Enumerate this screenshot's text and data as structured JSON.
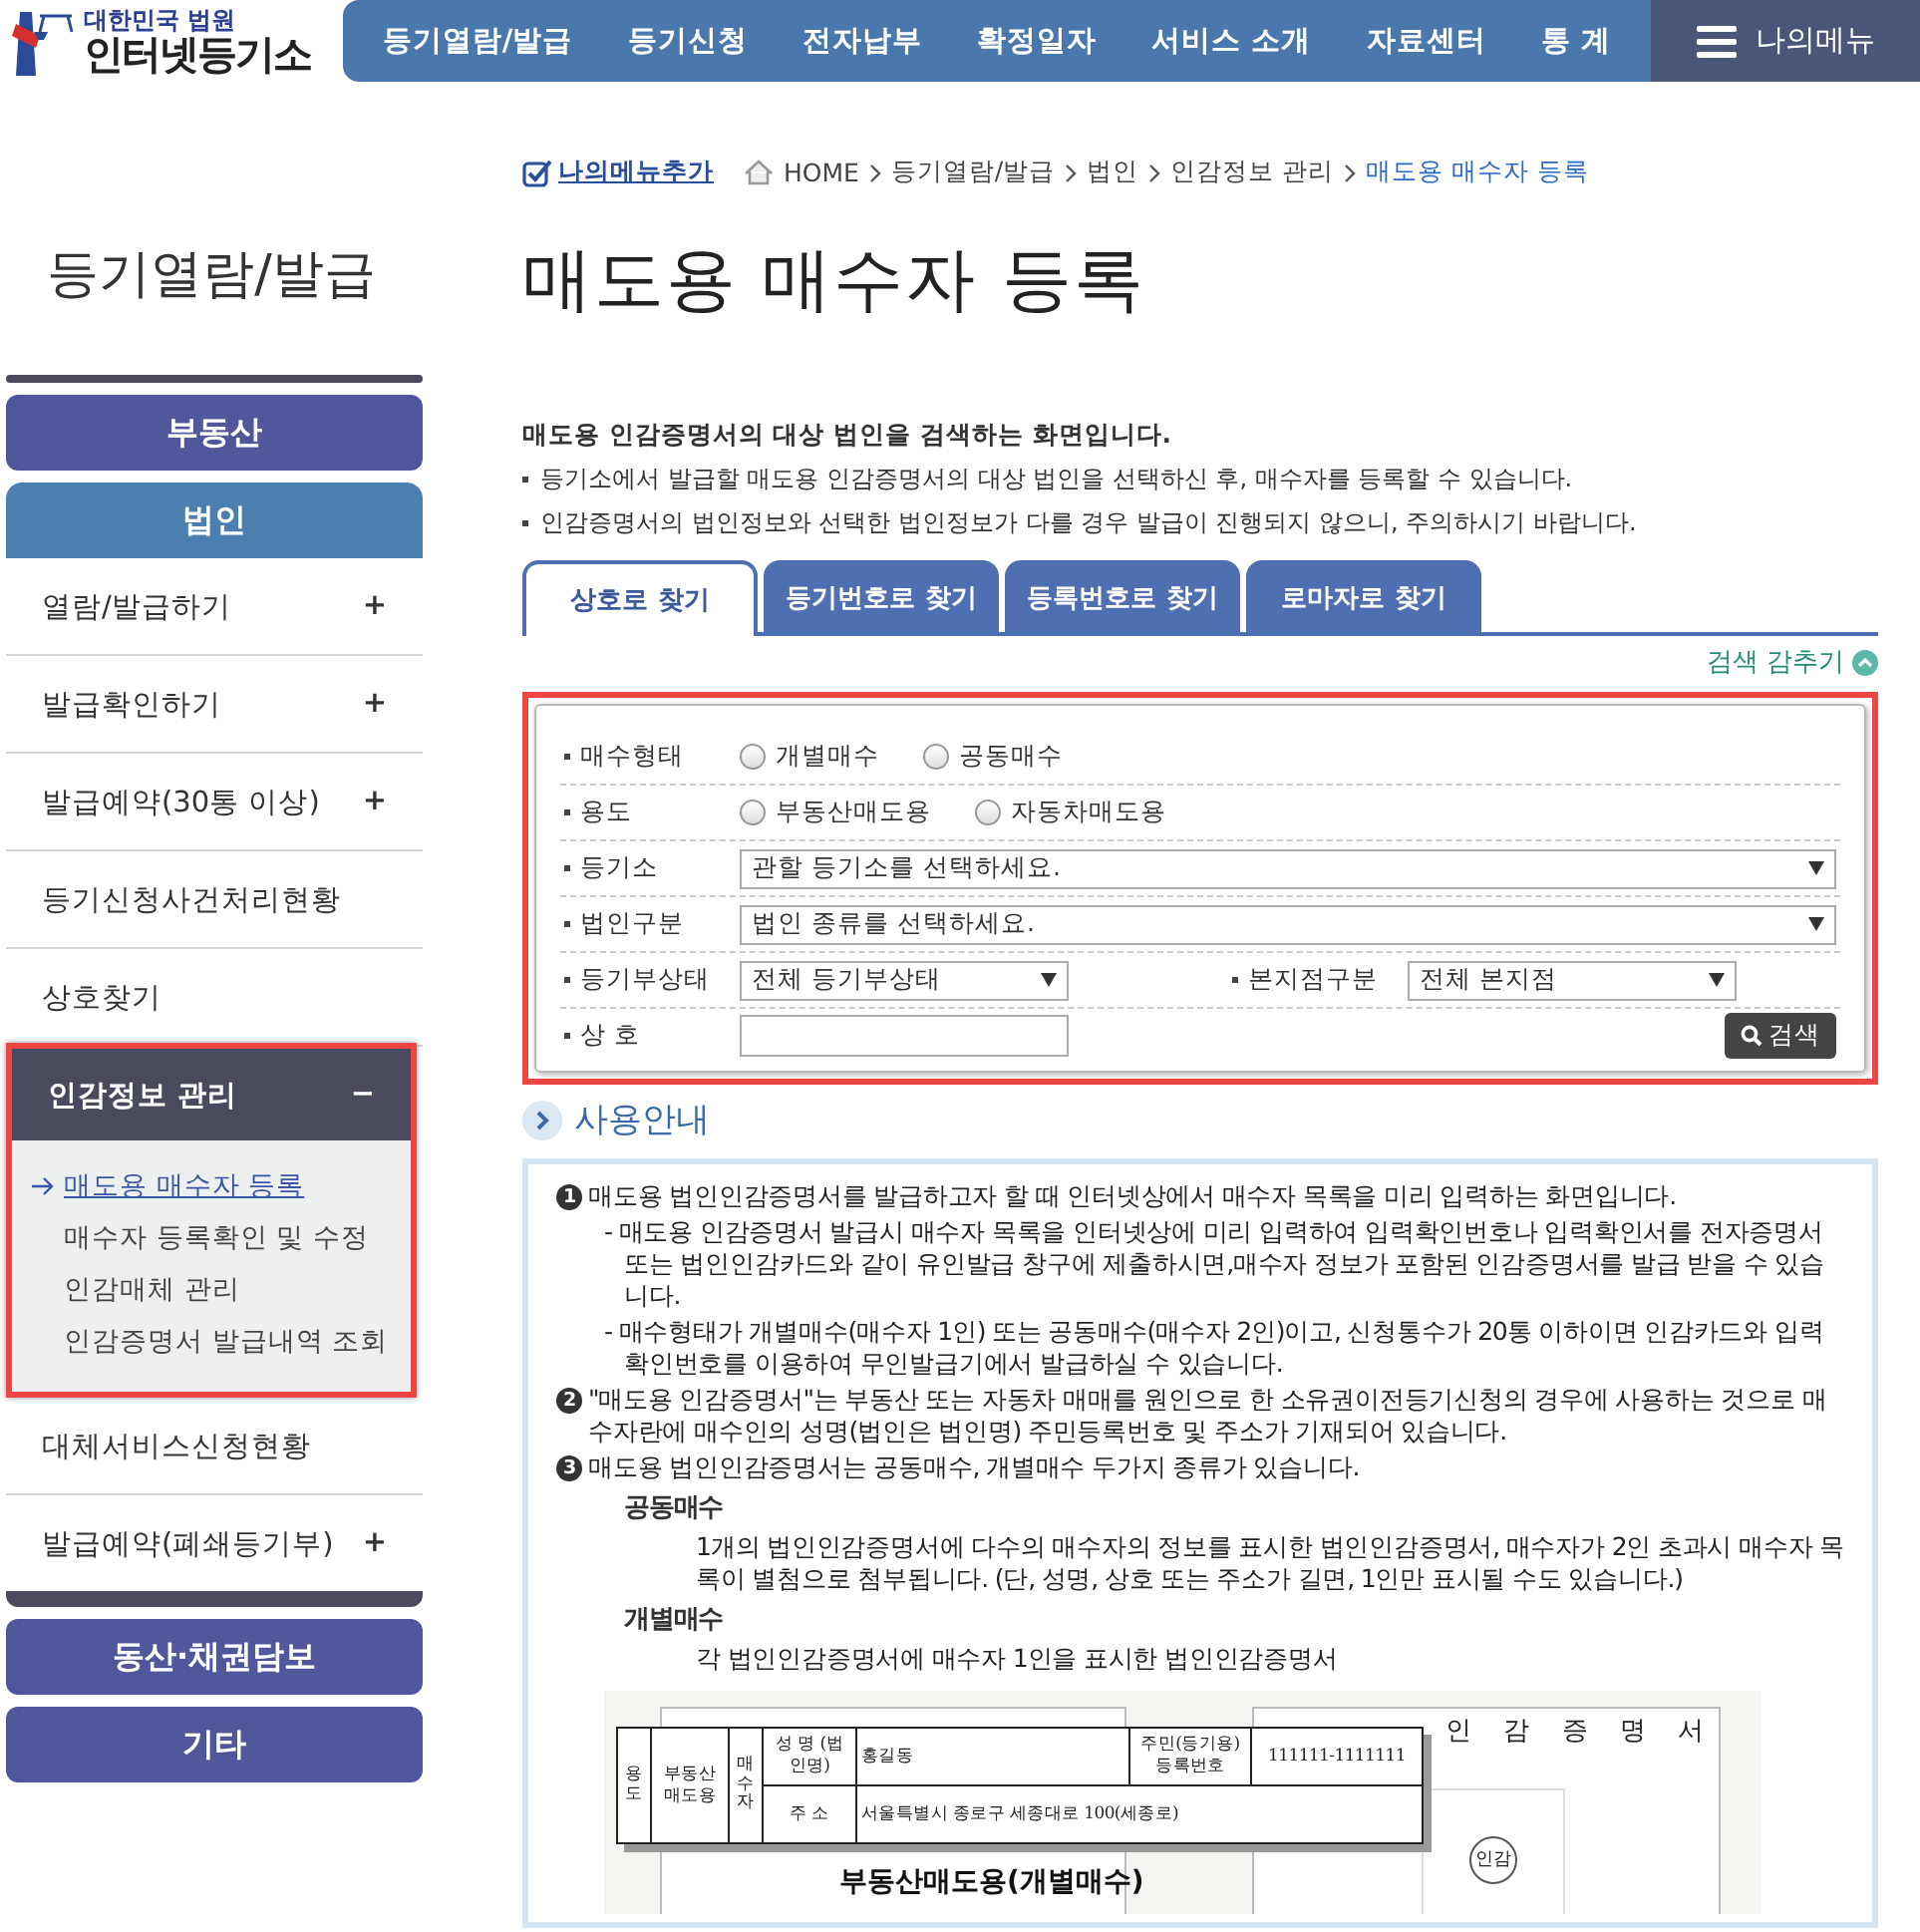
{
  "header": {
    "logo_top": "대한민국 법원",
    "logo_name": "인터넷등기소",
    "nav": [
      "등기열람/발급",
      "등기신청",
      "전자납부",
      "확정일자",
      "서비스 소개",
      "자료센터",
      "통 계"
    ],
    "my_menu": "나의메뉴"
  },
  "sidebar": {
    "title": "등기열람/발급",
    "sections": [
      {
        "label": "부동산",
        "selected": false
      },
      {
        "label": "법인",
        "selected": true,
        "items": [
          {
            "label": "열람/발급하기",
            "toggle": "+",
            "expanded": false
          },
          {
            "label": "발급확인하기",
            "toggle": "+",
            "expanded": false
          },
          {
            "label": "발급예약(30통 이상)",
            "toggle": "+",
            "expanded": false
          },
          {
            "label": "등기신청사건처리현황",
            "expanded": false
          },
          {
            "label": "상호찾기",
            "expanded": false
          },
          {
            "label": "인감정보 관리",
            "toggle": "−",
            "expanded": true,
            "highlighted": true,
            "children": [
              {
                "label": "매도용 매수자 등록",
                "selected": true
              },
              {
                "label": "매수자 등록확인 및 수정",
                "selected": false
              },
              {
                "label": "인감매체 관리",
                "selected": false
              },
              {
                "label": "인감증명서 발급내역 조회",
                "selected": false
              }
            ]
          },
          {
            "label": "대체서비스신청현황",
            "expanded": false
          },
          {
            "label": "발급예약(폐쇄등기부)",
            "toggle": "+",
            "expanded": false
          }
        ]
      },
      {
        "label": "동산·채권담보",
        "selected": false
      },
      {
        "label": "기타",
        "selected": false
      }
    ]
  },
  "breadcrumb": {
    "add_menu": "나의메뉴추가",
    "path": [
      "HOME",
      "등기열람/발급",
      "법인",
      "인감정보 관리",
      "매도용 매수자 등록"
    ]
  },
  "page_title": "매도용 매수자 등록",
  "intro": {
    "heading": "매도용 인감증명서의 대상 법인을 검색하는 화면입니다.",
    "bullets": [
      "등기소에서 발급할 매도용 인감증명서의 대상 법인을 선택하신 후, 매수자를 등록할 수 있습니다.",
      "인감증명서의 법인정보와 선택한 법인정보가 다를 경우 발급이 진행되지 않으니, 주의하시기 바랍니다."
    ]
  },
  "tabs": [
    {
      "label": "상호로 찾기",
      "selected": true
    },
    {
      "label": "등기번호로 찾기",
      "selected": false
    },
    {
      "label": "등록번호로 찾기",
      "selected": false
    },
    {
      "label": "로마자로 찾기",
      "selected": false
    }
  ],
  "search_toggle": "검색 감추기",
  "search_form": {
    "highlighted": true,
    "rows": [
      {
        "kind": "radio",
        "label": "매수형태",
        "options": [
          {
            "label": "개별매수",
            "checked": false
          },
          {
            "label": "공동매수",
            "checked": false
          }
        ]
      },
      {
        "kind": "radio",
        "label": "용도",
        "options": [
          {
            "label": "부동산매도용",
            "checked": false
          },
          {
            "label": "자동차매도용",
            "checked": false
          }
        ]
      },
      {
        "kind": "select",
        "label": "등기소",
        "value": "관할 등기소를 선택하세요."
      },
      {
        "kind": "select",
        "label": "법인구분",
        "value": "법인 종류를 선택하세요."
      },
      {
        "kind": "select_pair",
        "label": "등기부상태",
        "value": "전체 등기부상태",
        "label_2": "본지점구분",
        "value_2": "전체 본지점"
      },
      {
        "kind": "text",
        "label": "상 호",
        "button": "검색"
      }
    ]
  },
  "guide": {
    "title": "사용안내",
    "items": [
      {
        "number": "1",
        "text": "매도용 법인인감증명서를 발급하고자 할 때 인터넷상에서 매수자 목록을 미리 입력하는 화면입니다.",
        "notes": [
          "- 매도용 인감증명서 발급시 매수자 목록을 인터넷상에 미리 입력하여 입력확인번호나 입력확인서를 전자증명서 또는 법인인감카드와 같이 유인발급 창구에 제출하시면,매수자 정보가 포함된 인감증명서를 발급 받을 수 있습니다.",
          "- 매수형태가 개별매수(매수자 1인) 또는 공동매수(매수자 2인)이고, 신청통수가 20통 이하이면 인감카드와 입력확인번호를 이용하여 무인발급기에서 발급하실 수 있습니다."
        ]
      },
      {
        "number": "2",
        "text": "\"매도용 인감증명서\"는 부동산 또는 자동차 매매를 원인으로 한 소유권이전등기신청의 경우에 사용하는 것으로 매수자란에 매수인의 성명(법인은 법인명) 주민등록번호 및 주소가 기재되어 있습니다."
      },
      {
        "number": "3",
        "text": "매도용 법인인감증명서는 공동매수, 개별매수 두가지 종류가 있습니다.",
        "definitions": [
          {
            "term": "공동매수",
            "text": "1개의 법인인감증명서에 다수의 매수자의 정보를 표시한 법인인감증명서, 매수자가 2인 초과시 매수자 목록이 별첨으로 첨부됩니다. (단, 성명, 상호 또는 주소가 길면, 1인만 표시될 수도 있습니다.)"
          },
          {
            "term": "개별매수",
            "text": "각 법인인감증명서에 매수자 1인을 표시한 법인인감증명서"
          }
        ]
      }
    ],
    "sample": {
      "form_title": "인 감 증 명 서",
      "stamp": "인감",
      "caption": "부동산매도용(개별매수)",
      "table": {
        "usage_label": "용도",
        "usage": "부동산 매도용",
        "buyer_label": "매수자",
        "name_label": "성 명 (법인명)",
        "name": "홍길동",
        "id_label": "주민(등기용) 등록번호",
        "id": "111111-1111111",
        "address_label": "주 소",
        "address": "서울특별시 종로구 세종대로 100(세종로)"
      }
    }
  }
}
